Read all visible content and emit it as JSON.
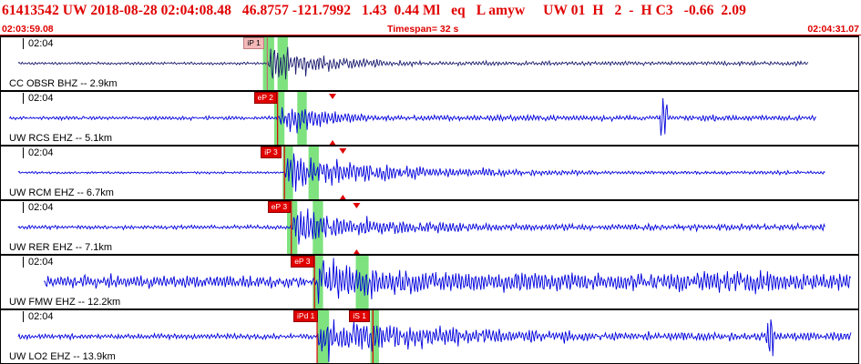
{
  "header": {
    "title": "61413542 UW 2018-08-28 02:04:08.48   46.8757 -121.7992   1.43  0.44 Ml   eq   L amyw     UW 01  H   2  -  H C3   -0.66  2.09",
    "start_time": "02:03:59.08",
    "timespan": "Timespan=  32 s",
    "end_time": "02:04:31.07"
  },
  "colors": {
    "header_text": "#e00000",
    "trace_first": "#1a1a6e",
    "trace": "#0000dd",
    "pick": "#e00000",
    "window": "#7ee27e"
  },
  "panels": [
    {
      "time_label": "02:04",
      "station": "CC OBSR BHZ -- 2.9km",
      "trace_color": "#1a1a6e",
      "trace_start": 0.02,
      "trace_end": 0.94,
      "noise": 0.06,
      "onset": 0.31,
      "amp": 0.95,
      "decay": 5.0,
      "burst": null,
      "picks": [
        {
          "label": "iP 1",
          "t": 0.31,
          "style": "pending"
        }
      ],
      "windows": [
        [
          0.305,
          0.318
        ],
        [
          0.322,
          0.334
        ]
      ],
      "marks": []
    },
    {
      "time_label": "02:04",
      "station": "UW RCS EHZ -- 5.1km",
      "trace_color": "#0000dd",
      "trace_start": 0.01,
      "trace_end": 0.95,
      "noise": 0.08,
      "onset": 0.322,
      "amp": 0.85,
      "decay": 6.0,
      "burst": 0.772,
      "picks": [
        {
          "label": "eP 2",
          "t": 0.322,
          "style": "auto"
        }
      ],
      "windows": [
        [
          0.318,
          0.33
        ],
        [
          0.345,
          0.356
        ]
      ],
      "marks": [
        0.386
      ]
    },
    {
      "time_label": "02:04",
      "station": "UW RCM EHZ -- 6.7km",
      "trace_color": "#0000dd",
      "trace_start": 0.02,
      "trace_end": 0.96,
      "noise": 0.05,
      "onset": 0.33,
      "amp": 0.9,
      "decay": 2.5,
      "burst": null,
      "picks": [
        {
          "label": "iP 3",
          "t": 0.33,
          "style": "auto"
        }
      ],
      "windows": [
        [
          0.328,
          0.34
        ],
        [
          0.358,
          0.37
        ]
      ],
      "marks": [
        0.398
      ]
    },
    {
      "time_label": "02:04",
      "station": "UW RER EHZ -- 7.1km",
      "trace_color": "#0000dd",
      "trace_start": 0.02,
      "trace_end": 0.96,
      "noise": 0.09,
      "onset": 0.338,
      "amp": 0.85,
      "decay": 3.0,
      "burst": null,
      "picks": [
        {
          "label": "eP 3",
          "t": 0.338,
          "style": "auto"
        }
      ],
      "windows": [
        [
          0.333,
          0.345
        ],
        [
          0.363,
          0.375
        ]
      ],
      "marks": [
        0.414
      ]
    },
    {
      "time_label": "02:04",
      "station": "UW FMW EHZ -- 12.2km",
      "trace_color": "#0000dd",
      "trace_start": 0.05,
      "trace_end": 0.99,
      "noise": 0.28,
      "onset": 0.365,
      "amp": 0.95,
      "decay": 3.5,
      "burst": null,
      "picks": [
        {
          "label": "eP 3",
          "t": 0.365,
          "style": "auto"
        }
      ],
      "windows": [
        [
          0.363,
          0.375
        ],
        [
          0.413,
          0.428
        ]
      ],
      "marks": []
    },
    {
      "time_label": "02:04",
      "station": "UW LO2 EHZ -- 13.9km",
      "trace_color": "#0000dd",
      "trace_start": 0.02,
      "trace_end": 0.99,
      "noise": 0.12,
      "onset": 0.368,
      "amp": 0.95,
      "decay": 2.0,
      "burst": 0.895,
      "picks": [
        {
          "label": "iPd 1",
          "t": 0.368,
          "style": "auto"
        },
        {
          "label": "iS 1",
          "t": 0.433,
          "style": "auto"
        }
      ],
      "windows": [
        [
          0.368,
          0.382
        ],
        [
          0.43,
          0.44
        ]
      ],
      "marks": []
    }
  ]
}
